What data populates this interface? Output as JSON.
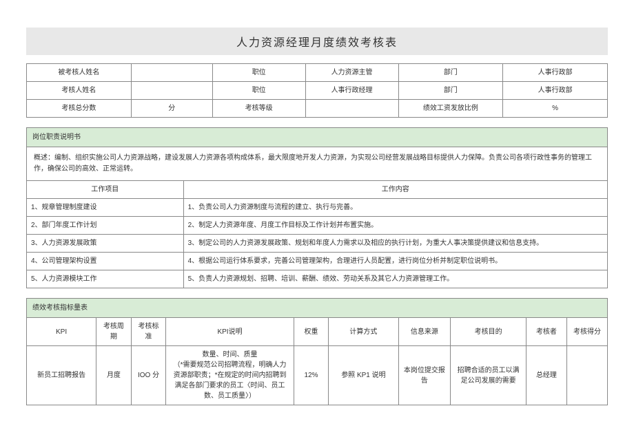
{
  "title": "人力资源经理月度绩效考核表",
  "info_table": {
    "r1": {
      "c1": "被考核人姓名",
      "c2": "",
      "c3": "职位",
      "c4": "人力资源主管",
      "c5": "部门",
      "c6": "人事行政部"
    },
    "r2": {
      "c1": "考核人姓名",
      "c2": "",
      "c3": "职位",
      "c4": "人事行政经理",
      "c5": "部门",
      "c6": "人事行政部"
    },
    "r3": {
      "c1": "考核总分数",
      "c2": "分",
      "c3": "考核等级",
      "c4": "",
      "c5": "绩效工资发放比例",
      "c6": "%"
    }
  },
  "duty": {
    "heading": "岗位职责说明书",
    "summary_label": "概述：",
    "summary_text": "编制、组织实施公司人力资源战略，建设发展人力资源各项构成体系，最大限度地开发人力资源，为实现公司经营发展战略目标提供人力保障。负责公司各项行政性事务的管理工作，确保公司的高效、正常运转。",
    "col1": "工作项目",
    "col2": "工作内容",
    "rows": [
      {
        "a": "1、规章管理制度建设",
        "b": "1、负责公司人力资源制度与流程的建立、执行与完善。"
      },
      {
        "a": "2、部门年度工作计划",
        "b": "2、制定人力资源年度、月度工作目标及工作计划并布置实施。"
      },
      {
        "a": "3、人力资源发展政策",
        "b": "3、制定公司的人力资源发展政策、规划和年度人力需求以及相应的执行计划，为重大人事决策提供建议和信息支持。"
      },
      {
        "a": "4、公司管理架构设置",
        "b": "4、根据公司运行体系要求，完善公司管理架构，合理进行人员配置，进行岗位分析并制定职位说明书。"
      },
      {
        "a": "5、人力资源模块工作",
        "b": "5、负责人力资源规划、招聘、培训、薪酬、绩效、劳动关系及其它人力资源管理工作。"
      }
    ]
  },
  "kpi": {
    "heading": "绩效考核指标量表",
    "headers": {
      "h1": "KPI",
      "h2": "考核周期",
      "h3": "考核标准",
      "h4": "KPI说明",
      "h5": "权重",
      "h6": "计算方式",
      "h7": "信息来源",
      "h8": "考核目的",
      "h9": "考核者",
      "h10": "考核得分"
    },
    "rows": [
      {
        "c1": "新员工招聘报告",
        "c2": "月度",
        "c3": "IOO 分",
        "c4_line1": "数量、时间、质量",
        "c4_line2": "（*需要规范公司招聘流程，明确人力资源部职责；*在规定的时间内招聘到满足各部门要求的员工〈时间、员工数、员工质量〉）",
        "c5": "12%",
        "c6": "参照 KP1 说明",
        "c7": "本岗位提交报告",
        "c8": "招聘合适的员工以满足公司发展的需要",
        "c9": "总经理",
        "c10": ""
      }
    ]
  }
}
